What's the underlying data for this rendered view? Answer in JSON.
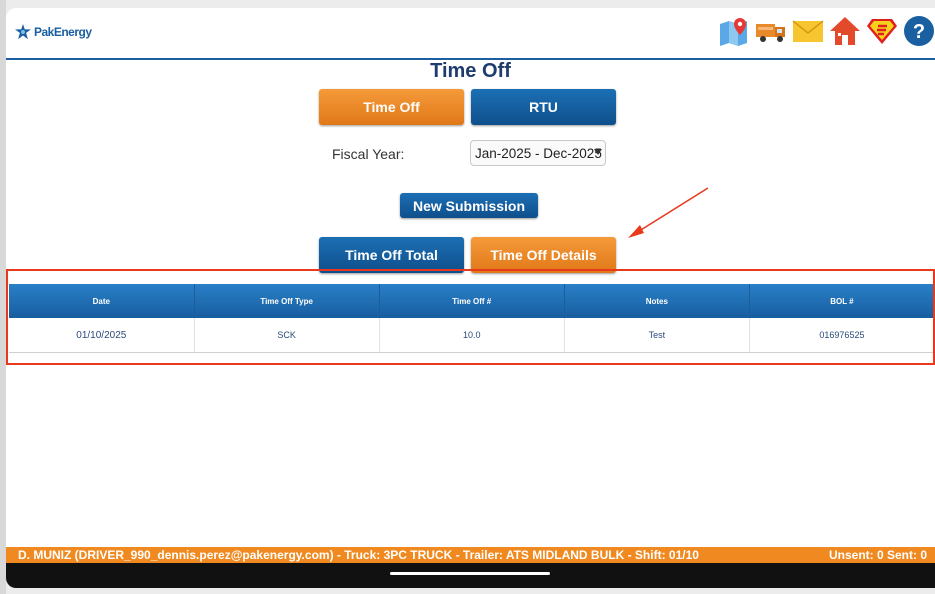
{
  "app": {
    "logo_text": "PakEnergy"
  },
  "header": {
    "icons": [
      "map-pin-icon",
      "truck-icon",
      "mail-icon",
      "home-icon",
      "superman-icon",
      "help-icon"
    ]
  },
  "page": {
    "title": "Time Off"
  },
  "tabs": {
    "time_off": "Time Off",
    "rtu": "RTU"
  },
  "fiscal": {
    "label": "Fiscal Year:",
    "value": "Jan-2025 - Dec-2025"
  },
  "actions": {
    "new_submission": "New Submission"
  },
  "subtabs": {
    "total": "Time Off Total",
    "details": "Time Off Details"
  },
  "table": {
    "headers": [
      "Date",
      "Time Off Type",
      "Time Off #",
      "Notes",
      "BOL #"
    ],
    "rows": [
      [
        "01/10/2025",
        "SCK",
        "10.0",
        "Test",
        "016976525"
      ]
    ]
  },
  "status": {
    "driver": "D. MUNIZ (DRIVER_990_dennis.perez@pakenergy.com)  -  Truck: 3PC TRUCK  -  Trailer: ATS MIDLAND BULK  -  Shift: 01/10",
    "counts": "Unsent: 0  Sent: 0"
  },
  "colors": {
    "orange": "#f08a20",
    "blue": "#175d9f",
    "annotation_red": "#e8391d"
  }
}
